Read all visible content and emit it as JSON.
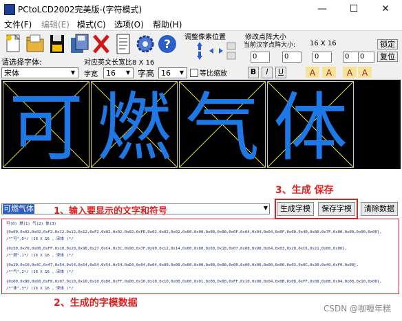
{
  "window": {
    "title": "PCtoLCD2002完美版-(字符模式)",
    "minimize": "—",
    "maximize": "☐",
    "close": "✕"
  },
  "menu": [
    "文件(F)",
    "编辑(E)",
    "模式(C)",
    "选项(O)",
    "帮助(H)"
  ],
  "toolbar": {
    "pixel_group_label": "调整像素位置",
    "matrix_group_label": "修改点阵大小",
    "current_dots_label": "当前汉字点阵大小:",
    "current_dots_value": "16 X 16",
    "lock_label": "锁定",
    "reset_label": "复位",
    "spins": [
      "0",
      "0",
      "0",
      "0",
      "0"
    ],
    "font_label": "请选择字体:",
    "font_value": "宋体",
    "english_ratio_label": "对应英文长宽比8 X 16",
    "width_label": "字宽",
    "width_value": "16",
    "height_label": "字高",
    "height_value": "16",
    "scale_label": "等比缩放",
    "bold": "B",
    "italic": "I",
    "underline": "U"
  },
  "preview_chars": [
    "可",
    "燃",
    "气",
    "体"
  ],
  "annotations": {
    "step1": "1、输入要显示的文字和符号",
    "step2": "2、生成的字模数据",
    "step3": "3、生成 保存"
  },
  "input": {
    "value": "可燃气体"
  },
  "buttons": {
    "generate": "生成字模",
    "save": "保存字模",
    "clear": "清除数据"
  },
  "output": {
    "header": "可(0) 燃(1) 气(2) 体(3)",
    "lines": [
      "{0x00,0x02,0x02,0xF2,0x12,0x12,0x12,0xF2,0x02,0x02,0x02,0xFE,0x02,0x02,0x02,0x00,0x00,0x00,0x00,0x0F,0x04,0x04,0x04,0x0F,0x00,0x40,0x80,0x7F,0x00,0x00,0x00,0x00},",
      "/*\"可\",0*/ (16 X 16 , 宋体 )*/",
      "{0x50,0x70,0x00,0xFF,0x10,0x28,0x98,0x27,0xC4,0x3C,0x90,0x7F,0x90,0x12,0x14,0x00,0x80,0x60,0x18,0x07,0x08,0x98,0x64,0x03,0x28,0xC6,0x21,0x00,0x00},",
      "/*\"燃\",1*/ (16 X 16 , 宋体 )*/",
      "{0x20,0x10,0x4C,0x47,0x54,0x54,0x54,0x54,0x54,0x54,0xD4,0x04,0x04,0x00,0x00,0x00,0x00,0x00,0x00,0x00,0x00,0x00,0x00,0x00,0x03,0x0C,0x30,0x40,0xF0,0x00},",
      "/*\"气\",2*/ (16 X 16 , 宋体 )*/",
      "{0x00,0x80,0x60,0xF8,0x07,0x10,0x10,0x10,0xD0,0xFF,0xD0,0x10,0x10,0x10,0x00,0x00,0x01,0x00,0x00,0xFF,0x10,0x08,0x04,0x0B,0x08,0xFF,0x08,0x0B,0x04,0x08,0x10,0x00},",
      "/*\"体\",3*/ (16 X 16 , 宋体 )*/"
    ]
  },
  "watermark": "CSDN @咖喱年糕",
  "colors": {
    "dot": "#1e78e6",
    "grid": "#e6dc3a",
    "annotation": "#e02020",
    "output_text": "#1a2a78"
  }
}
